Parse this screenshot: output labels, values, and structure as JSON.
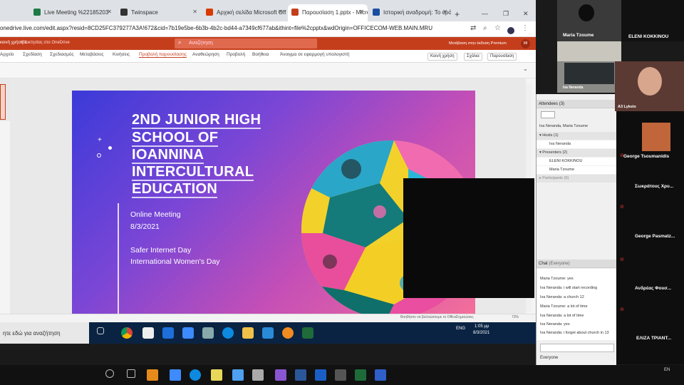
{
  "browser": {
    "tabs": [
      {
        "label": "Live Meeting %22185203",
        "color": "#1e7b46"
      },
      {
        "label": "Twinspace",
        "color": "#333333"
      },
      {
        "label": "Αρχική σελίδα Microsoft Off",
        "color": "#d83b01"
      },
      {
        "label": "Παρουσίαση 1.pptx - Micro",
        "color": "#c43e1c"
      },
      {
        "label": "Ιστορική αναδρομή: Το ορό",
        "color": "#1a4fa0"
      }
    ],
    "new_tab": "+",
    "url": "onedrive.live.com/edit.aspx?resid=8CD25FC379277A3A!672&cid=7b19e5be-6b3b-4b2c-bd44-a7349cf677ab&ithint=file%2cpptx&wdOrigin=OFFICECOM-WEB.MAIN.MRU"
  },
  "office": {
    "doc_label": "κοινή χρήση 1",
    "sub_label": "Ιδιοκτησίας στο OneDrive",
    "search_placeholder": "Αναζήτηση",
    "right_label": "Μετάβαση στην έκδοση Premium",
    "avatar": "MI"
  },
  "ribbon": {
    "tabs": [
      "Αρχείο",
      "Σχεδίαση",
      "Σχεδιασμός",
      "Μεταβάσεις",
      "Κινήσεις",
      "Προβολή παρουσίασης",
      "Αναθεώρηση",
      "Προβολή",
      "Βοήθεια",
      "Άνοιγμα σε εφαρμογή υπολογιστή"
    ],
    "active": "Προβολή παρουσίασης",
    "share": "Κοινή χρήση",
    "comments": "Σχόλια",
    "present": "Παρουσίαση"
  },
  "slide": {
    "title_lines": [
      "2ND JUNIOR HIGH",
      "SCHOOL OF",
      "IOANNINA",
      "INTERCULTURAL",
      "EDUCATION"
    ],
    "meeting": "Online Meeting",
    "date": "8/3/2021",
    "event1": "Safer Internet Day",
    "event2": "International Women's Day"
  },
  "statusbar": {
    "left": "Διαφάνεια 1 από 1",
    "mid": "Βοηθήστε να βελτιώσουμε το Office",
    "notes": "Σημειώσεις",
    "zoom": "73%"
  },
  "taskbar1": {
    "search": "ητε εδώ για αναζήτηση",
    "lang": "ENG",
    "time": "1:05 μμ",
    "date": "8/3/2021"
  },
  "attendees": {
    "title": "Attendees",
    "count": "(3)",
    "filter": "Iva Neranda, Maria Tzoume",
    "hosts_label": "Hosts",
    "hosts_count": "(1)",
    "hosts": [
      "Iva Neranda"
    ],
    "presenters_label": "Presenters",
    "presenters_count": "(2)",
    "presenters": [
      "ELENI KOKKINOU",
      "Maria Tzoume"
    ],
    "participants_label": "Participants",
    "participants_count": "(0)"
  },
  "chat": {
    "title": "Chat",
    "scope": "(Everyone)",
    "messages": [
      "Maria Tzoume: yes",
      "Iva Neranda: i will start recording",
      "Iva Neranda: a church 12",
      "Maria Tzoume: a lot of time",
      "Iva Neranda: a lot of time",
      "Iva Neranda: yes",
      "Iva Neranda: i forget about church in 13"
    ],
    "recipient": "Everyone"
  },
  "video": {
    "tiles": [
      "Maria Tzoume",
      "ELENI KOKKINOU",
      "Iva Neranda",
      "A3 Lykeio",
      "George Tsoumanidis",
      "Σωκράτους Χρυ...",
      "George Pasmatz...",
      "Ανδρέας Φουσ...",
      "ΕΛΙΖΑ ΤΡΙΑΝΤ..."
    ],
    "lang": "EN"
  }
}
